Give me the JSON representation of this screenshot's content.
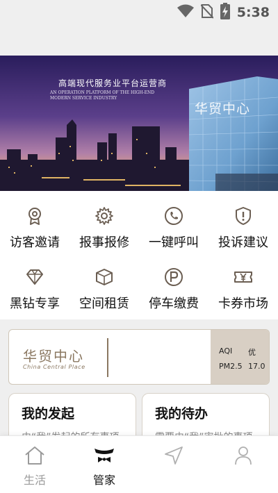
{
  "status_bar": {
    "time": "5:38"
  },
  "banner": {
    "headline": "高端现代服务业平台运营商",
    "subline": "AN OPERATION PLATFORM OF THE HIGH-END MODERN SERVICE INDUSTRY",
    "building_sign": "华贸中心"
  },
  "services": [
    {
      "label": "访客邀请",
      "icon": "visitor-badge-icon"
    },
    {
      "label": "报事报修",
      "icon": "gear-icon"
    },
    {
      "label": "一键呼叫",
      "icon": "phone-icon"
    },
    {
      "label": "投诉建议",
      "icon": "shield-alert-icon"
    },
    {
      "label": "黑钻专享",
      "icon": "diamond-icon"
    },
    {
      "label": "空间租赁",
      "icon": "box-icon"
    },
    {
      "label": "停车缴费",
      "icon": "parking-icon"
    },
    {
      "label": "卡券市场",
      "icon": "ticket-yen-icon"
    }
  ],
  "center_card": {
    "logo_cn": "华贸中心",
    "logo_en": "China Central Place",
    "aqi_label": "AQI",
    "aqi_value": "优",
    "pm_label": "PM2.5",
    "pm_value": "17.0"
  },
  "tasks": [
    {
      "title": "我的发起",
      "desc": "由“我”发起的所有事项"
    },
    {
      "title": "我的待办",
      "desc": "需要由“我”审批的事项"
    }
  ],
  "bottom_nav": [
    {
      "label": "生活",
      "icon": "home-icon",
      "active": false
    },
    {
      "label": "管家",
      "icon": "butler-bowtie-icon",
      "active": true
    },
    {
      "label": "",
      "icon": "navigate-icon",
      "active": false
    },
    {
      "label": "",
      "icon": "person-icon",
      "active": false
    }
  ],
  "colors": {
    "accent": "#8a7760",
    "aqi_panel": "#d8cfc4",
    "icon_stroke": "#6b5e52"
  }
}
